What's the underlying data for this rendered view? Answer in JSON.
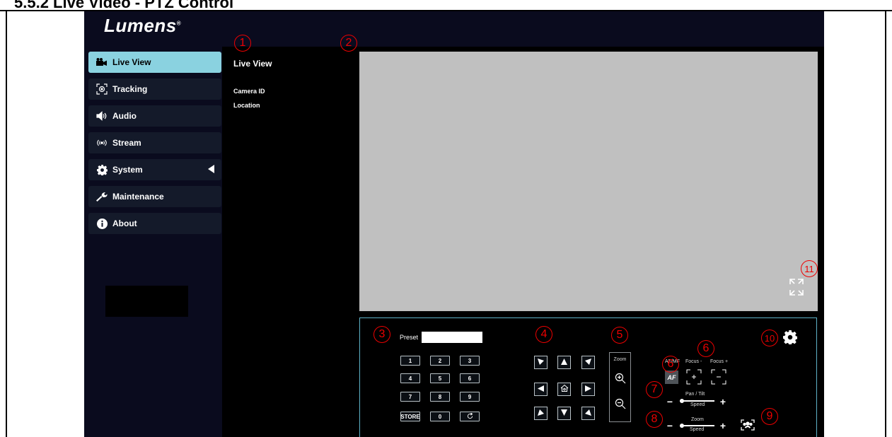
{
  "section_heading": "5.5.2 Live Video - PTZ Control",
  "app": {
    "logo": "Lumens",
    "logo_mark": "®"
  },
  "sidebar": {
    "items": [
      {
        "label": "Live View",
        "icon": "camera-icon",
        "active": true
      },
      {
        "label": "Tracking",
        "icon": "tracking-icon"
      },
      {
        "label": "Audio",
        "icon": "speaker-icon"
      },
      {
        "label": "Stream",
        "icon": "broadcast-icon"
      },
      {
        "label": "System",
        "icon": "gear-icon"
      },
      {
        "label": "Maintenance",
        "icon": "wrench-icon"
      },
      {
        "label": "About",
        "icon": "info-icon"
      }
    ]
  },
  "info_panel": {
    "title": "Live View",
    "camera_id_label": "Camera ID",
    "location_label": "Location"
  },
  "preset": {
    "label": "Preset",
    "value": "",
    "keys": [
      "1",
      "2",
      "3",
      "4",
      "5",
      "6",
      "7",
      "8",
      "9",
      "STORE",
      "0"
    ]
  },
  "zoom": {
    "label": "Zoom"
  },
  "focus": {
    "af_mf_label": "AF/MF",
    "af_button": "AF",
    "focus_minus_label": "Focus -",
    "focus_plus_label": "Focus +"
  },
  "pan_tilt_speed": {
    "label_top": "Pan / Tilt",
    "label_bottom": "Speed",
    "minus": "−",
    "plus": "+"
  },
  "zoom_speed": {
    "label_top": "Zoom",
    "label_bottom": "Speed",
    "minus": "−",
    "plus": "+"
  },
  "callouts": [
    "1",
    "2",
    "3",
    "4",
    "5",
    "6",
    "6",
    "7",
    "8",
    "9",
    "10",
    "11"
  ],
  "colors": {
    "active_nav": "#8ad2e0",
    "panel_border": "#5fb3c9",
    "callout": "#e00000",
    "video_bg": "#c0c0c0"
  }
}
